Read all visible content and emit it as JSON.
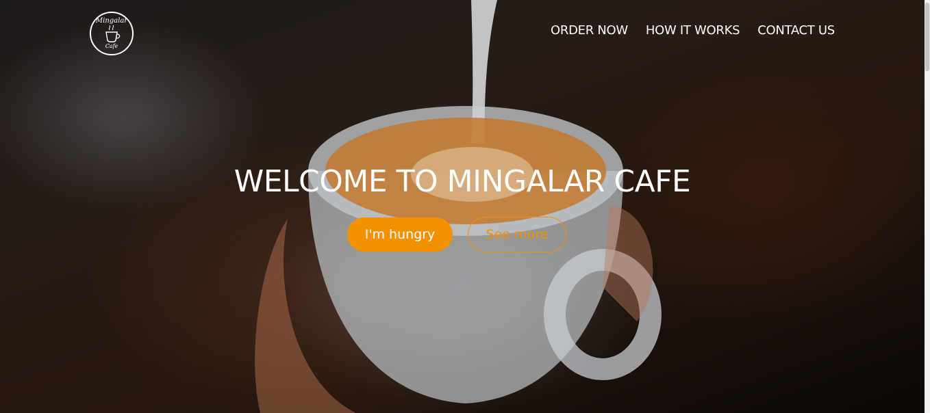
{
  "brand": {
    "logo_name": "Mingalar",
    "logo_sub": "Cafe",
    "logo_icon": "coffee-cup-icon"
  },
  "nav": {
    "items": [
      {
        "label": "ORDER NOW"
      },
      {
        "label": "HOW IT WORKS"
      },
      {
        "label": "CONTACT US"
      }
    ]
  },
  "hero": {
    "title": "WELCOME TO MINGALAR CAFE",
    "primary_button": "I'm hungry",
    "secondary_button": "See more"
  },
  "colors": {
    "accent": "#f39200",
    "text": "#ffffff"
  }
}
